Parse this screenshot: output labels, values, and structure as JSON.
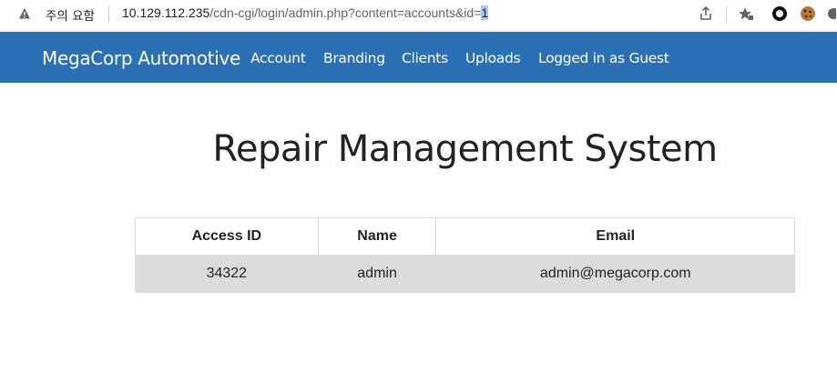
{
  "browser": {
    "security_warning": "주의 요함",
    "url_host": "10.129.112.235",
    "url_path": "/cdn-cgi/login/admin.php?content=accounts&id=",
    "url_selected": "1",
    "icons": [
      "warning-icon",
      "share-icon",
      "bookmark-star-icon",
      "circle-extension-icon",
      "cookie-extension-icon",
      "settings-icon"
    ]
  },
  "navbar": {
    "brand": "MegaCorp Automotive",
    "items": [
      "Account",
      "Branding",
      "Clients",
      "Uploads",
      "Logged in as Guest"
    ],
    "color": "#2b70b5"
  },
  "main": {
    "title": "Repair Management System",
    "table": {
      "headers": [
        "Access ID",
        "Name",
        "Email"
      ],
      "rows": [
        [
          "34322",
          "admin",
          "admin@megacorp.com"
        ]
      ]
    }
  }
}
